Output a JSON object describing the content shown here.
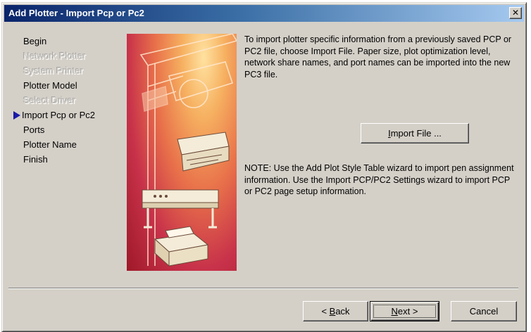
{
  "window": {
    "title": "Add Plotter - Import Pcp or Pc2",
    "close_glyph": "✕"
  },
  "steps": [
    {
      "label": "Begin",
      "state": "enabled"
    },
    {
      "label": "Network Plotter",
      "state": "disabled"
    },
    {
      "label": "System Printer",
      "state": "disabled"
    },
    {
      "label": "Plotter Model",
      "state": "enabled"
    },
    {
      "label": "Select Driver",
      "state": "disabled"
    },
    {
      "label": "Import Pcp or Pc2",
      "state": "current"
    },
    {
      "label": "Ports",
      "state": "enabled"
    },
    {
      "label": "Plotter Name",
      "state": "enabled"
    },
    {
      "label": "Finish",
      "state": "enabled"
    }
  ],
  "content": {
    "intro": "To import plotter specific information from a previously saved PCP or PC2 file, choose Import File. Paper size, plot optimization level, network share names, and port names can be imported into the new PC3 file.",
    "note": "NOTE: Use the Add Plot Style Table wizard to import pen assignment information. Use the Import PCP/PC2 Settings wizard to import PCP or PC2 page setup information."
  },
  "buttons": {
    "import_mnemonic": "I",
    "import_rest": "mport File ...",
    "back_prefix": "< ",
    "back_mnemonic": "B",
    "back_rest": "ack",
    "next_mnemonic": "N",
    "next_rest": "ext >",
    "cancel": "Cancel"
  },
  "colors": {
    "title_gradient_start": "#0a246a",
    "title_gradient_end": "#a6caf0",
    "dialog_face": "#d4d0c8",
    "step_arrow": "#1a1aa8"
  },
  "icons": [
    "close-icon",
    "current-step-arrow-icon",
    "plotter-illustration"
  ]
}
